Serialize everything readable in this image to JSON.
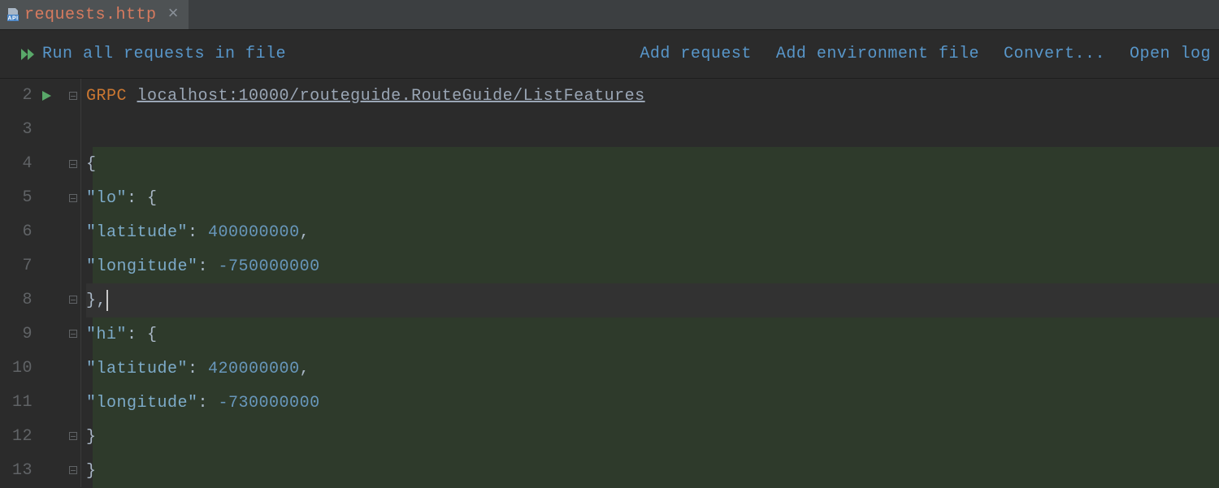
{
  "tab": {
    "filename": "requests.http",
    "icon_label": "API"
  },
  "actions": {
    "run_all": "Run all requests in file",
    "add_request": "Add request",
    "add_env_file": "Add environment file",
    "convert": "Convert...",
    "open_log": "Open log"
  },
  "line_numbers": [
    "2",
    "3",
    "4",
    "5",
    "6",
    "7",
    "8",
    "9",
    "10",
    "11",
    "12",
    "13"
  ],
  "code": {
    "method": "GRPC",
    "url": "localhost:10000/routeguide.RouteGuide/ListFeatures",
    "json": {
      "lo": {
        "latitude": "400000000",
        "longitude": "-750000000"
      },
      "hi": {
        "latitude": "420000000",
        "longitude": "-730000000"
      }
    }
  }
}
